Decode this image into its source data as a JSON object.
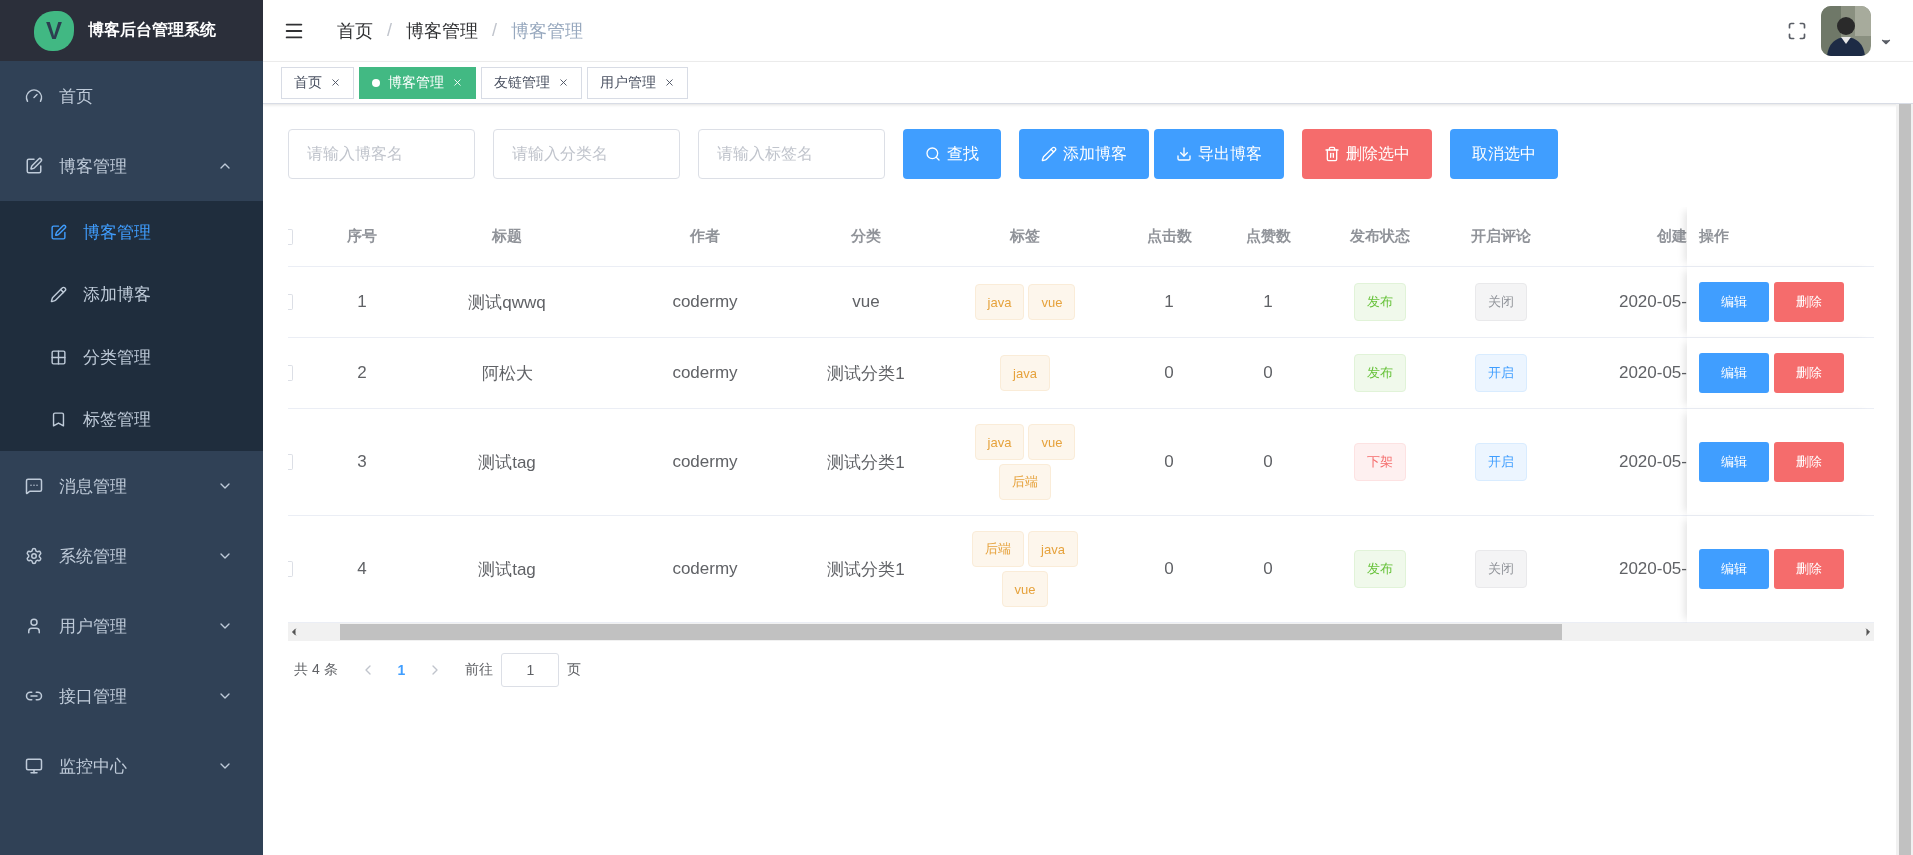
{
  "sidebar": {
    "logo_letter": "V",
    "title": "博客后台管理系统",
    "items": [
      {
        "label": "首页",
        "kind": "link",
        "selected": false
      },
      {
        "label": "博客管理",
        "kind": "menu",
        "expanded": true,
        "selected": false,
        "children": [
          {
            "label": "博客管理",
            "selected": true
          },
          {
            "label": "添加博客",
            "selected": false
          },
          {
            "label": "分类管理",
            "selected": false
          },
          {
            "label": "标签管理",
            "selected": false
          }
        ]
      },
      {
        "label": "消息管理",
        "kind": "menu",
        "expanded": false,
        "selected": false
      },
      {
        "label": "系统管理",
        "kind": "menu",
        "expanded": false,
        "selected": false
      },
      {
        "label": "用户管理",
        "kind": "menu",
        "expanded": false,
        "selected": false
      },
      {
        "label": "接口管理",
        "kind": "menu",
        "expanded": false,
        "selected": false
      },
      {
        "label": "监控中心",
        "kind": "menu",
        "expanded": false,
        "selected": false
      }
    ]
  },
  "breadcrumb_separator": "/",
  "breadcrumb": [
    {
      "label": "首页",
      "current": false
    },
    {
      "label": "博客管理",
      "current": false
    },
    {
      "label": "博客管理",
      "current": true
    }
  ],
  "tabs": [
    {
      "label": "首页",
      "selected": false
    },
    {
      "label": "博客管理",
      "selected": true
    },
    {
      "label": "友链管理",
      "selected": false
    },
    {
      "label": "用户管理",
      "selected": false
    }
  ],
  "search_fields": [
    {
      "placeholder": "请输入博客名"
    },
    {
      "placeholder": "请输入分类名"
    },
    {
      "placeholder": "请输入标签名"
    }
  ],
  "buttons": [
    {
      "label": "查找",
      "kind": "primary"
    },
    {
      "label": "添加博客",
      "kind": "primary"
    },
    {
      "label": "导出博客",
      "kind": "primary"
    },
    {
      "label": "删除选中",
      "kind": "danger"
    },
    {
      "label": "取消选中",
      "kind": "primary"
    }
  ],
  "table": {
    "select_all": {
      "checked": false
    },
    "columns": [
      "序号",
      "标题",
      "作者",
      "分类",
      "标签",
      "点击数",
      "点赞数",
      "发布状态",
      "开启评论",
      "创建"
    ],
    "fixed_column": "操作",
    "rows": [
      {
        "checked": false,
        "index": "1",
        "title": "测试qwwq",
        "author": "codermy",
        "category": "vue",
        "tags": [
          "java",
          "vue"
        ],
        "clicks": "1",
        "likes": "1",
        "publish": {
          "label": "发布",
          "kind": "success"
        },
        "comment": {
          "label": "关闭",
          "kind": "info"
        },
        "created": "2020-05-",
        "actions": [
          {
            "label": "编辑",
            "kind": "primary"
          },
          {
            "label": "删除",
            "kind": "danger"
          }
        ]
      },
      {
        "checked": false,
        "index": "2",
        "title": "阿松大",
        "author": "codermy",
        "category": "测试分类1",
        "tags": [
          "java"
        ],
        "clicks": "0",
        "likes": "0",
        "publish": {
          "label": "发布",
          "kind": "success"
        },
        "comment": {
          "label": "开启",
          "kind": "primary"
        },
        "created": "2020-05-",
        "actions": [
          {
            "label": "编辑",
            "kind": "primary"
          },
          {
            "label": "删除",
            "kind": "danger"
          }
        ]
      },
      {
        "checked": false,
        "index": "3",
        "title": "测试tag",
        "author": "codermy",
        "category": "测试分类1",
        "tags": [
          "java",
          "vue",
          "后端"
        ],
        "clicks": "0",
        "likes": "0",
        "publish": {
          "label": "下架",
          "kind": "danger"
        },
        "comment": {
          "label": "开启",
          "kind": "primary"
        },
        "created": "2020-05-",
        "actions": [
          {
            "label": "编辑",
            "kind": "primary"
          },
          {
            "label": "删除",
            "kind": "danger"
          }
        ]
      },
      {
        "checked": false,
        "index": "4",
        "title": "测试tag",
        "author": "codermy",
        "category": "测试分类1",
        "tags": [
          "后端",
          "java",
          "vue"
        ],
        "clicks": "0",
        "likes": "0",
        "publish": {
          "label": "发布",
          "kind": "success"
        },
        "comment": {
          "label": "关闭",
          "kind": "info"
        },
        "created": "2020-05-",
        "actions": [
          {
            "label": "编辑",
            "kind": "primary"
          },
          {
            "label": "删除",
            "kind": "danger"
          }
        ]
      }
    ]
  },
  "pagination": {
    "total": "共 4 条",
    "prev_disabled": true,
    "pages": [
      {
        "label": "1",
        "selected": true
      }
    ],
    "next_disabled": true,
    "goto_label": "前往",
    "goto_value": "1",
    "page_suffix": "页"
  }
}
